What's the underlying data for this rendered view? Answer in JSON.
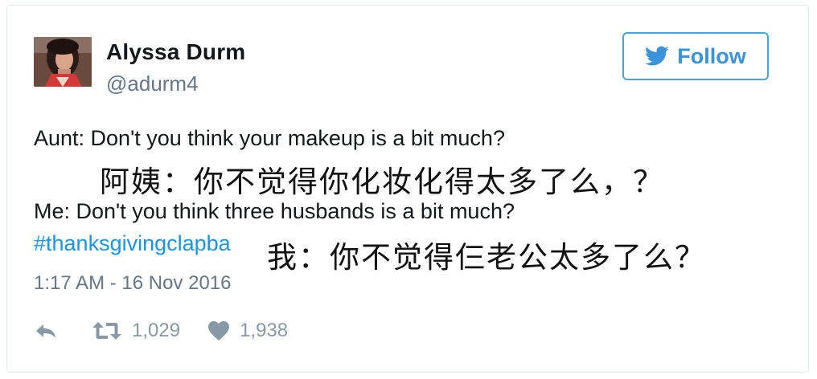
{
  "user": {
    "display_name": "Alyssa Durm",
    "handle": "@adurm4"
  },
  "follow_button": {
    "label": "Follow"
  },
  "tweet": {
    "line1": "Aunt: Don't you think your makeup is a bit much?",
    "line2": "Me: Don't you think three husbands is a bit much?",
    "hashtag": "#thanksgivingclapba",
    "timestamp": "1:17 AM - 16 Nov 2016"
  },
  "overlay_text": {
    "line1": "阿姨：你不觉得你化妆化得太多了么，？",
    "line2": "我：你不觉得仨老公太多了么？"
  },
  "actions": {
    "retweet_count": "1,029",
    "like_count": "1,938"
  },
  "colors": {
    "accent": "#1b95e0",
    "follow_border": "#4aa3df",
    "muted": "#657786",
    "icon": "#8899a6"
  }
}
